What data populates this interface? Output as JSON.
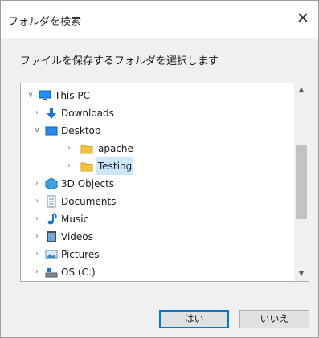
{
  "dialog": {
    "title": "フォルダを検索",
    "instruction": "ファイルを保存するフォルダを選択します",
    "ok_label": "はい",
    "cancel_label": "いいえ"
  },
  "tree": {
    "items": [
      {
        "label": "This PC",
        "icon": "computer-icon",
        "expander": "expanded"
      },
      {
        "label": "Downloads",
        "icon": "downloads-icon",
        "expander": "collapsed"
      },
      {
        "label": "Desktop",
        "icon": "desktop-icon",
        "expander": "expanded"
      },
      {
        "label": "apache",
        "icon": "folder-icon",
        "expander": "collapsed"
      },
      {
        "label": "Testing",
        "icon": "folder-icon",
        "expander": "collapsed",
        "selected": true
      },
      {
        "label": "3D Objects",
        "icon": "3d-objects-icon",
        "expander": "collapsed"
      },
      {
        "label": "Documents",
        "icon": "documents-icon",
        "expander": "collapsed"
      },
      {
        "label": "Music",
        "icon": "music-icon",
        "expander": "collapsed"
      },
      {
        "label": "Videos",
        "icon": "videos-icon",
        "expander": "collapsed"
      },
      {
        "label": "Pictures",
        "icon": "pictures-icon",
        "expander": "collapsed"
      },
      {
        "label": "OS (C:)",
        "icon": "drive-icon",
        "expander": "collapsed"
      }
    ]
  },
  "colors": {
    "accent": "#0078d7",
    "selection": "#cce8ff",
    "folder": "#f3c33b"
  }
}
